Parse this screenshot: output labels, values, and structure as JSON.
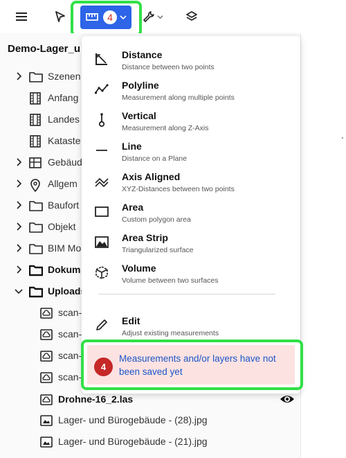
{
  "toolbar": {
    "menu_icon": "hamburger-icon",
    "select_icon": "cursor-arrow-icon",
    "measure_icon": "ruler-icon",
    "measure_badge": "4",
    "tools_icon": "wrench-icon",
    "layers_icon": "layers-icon",
    "accent_color": "#2d64e8"
  },
  "project": {
    "title": "Demo-Lager_u"
  },
  "tree": [
    {
      "label": "Szenen",
      "icon": "folder-icon",
      "bold": false,
      "chevron": "right"
    },
    {
      "label": "Anfang",
      "icon": "film-icon",
      "bold": false,
      "chevron": ""
    },
    {
      "label": "Landes",
      "icon": "film-icon",
      "bold": false,
      "chevron": ""
    },
    {
      "label": "Kataste",
      "icon": "film-icon",
      "bold": false,
      "chevron": ""
    },
    {
      "label": "Gebäud",
      "icon": "building-icon",
      "bold": false,
      "chevron": "right"
    },
    {
      "label": "Allgem",
      "icon": "location-pin-icon",
      "bold": false,
      "chevron": "right"
    },
    {
      "label": "Baufort",
      "icon": "folder-icon",
      "bold": false,
      "chevron": "right"
    },
    {
      "label": "Objekt",
      "icon": "folder-icon",
      "bold": false,
      "chevron": "right"
    },
    {
      "label": "BIM Mo",
      "icon": "folder-icon",
      "bold": false,
      "chevron": "right"
    },
    {
      "label": "Dokum",
      "icon": "folder-icon",
      "bold": true,
      "chevron": "right"
    },
    {
      "label": "Uploads",
      "icon": "folder-icon",
      "bold": true,
      "chevron": "down"
    },
    {
      "label": "scan-",
      "icon": "cloud-file-icon",
      "bold": false,
      "chevron": ""
    },
    {
      "label": "scan-",
      "icon": "cloud-file-icon",
      "bold": false,
      "chevron": ""
    },
    {
      "label": "scan-",
      "icon": "cloud-file-icon",
      "bold": false,
      "chevron": ""
    },
    {
      "label": "scan-",
      "icon": "cloud-file-icon",
      "bold": false,
      "chevron": ""
    },
    {
      "label": "Drohne-16_2.las",
      "icon": "cloud-file-icon",
      "bold": true,
      "chevron": "",
      "visible_eye": true
    },
    {
      "label": "Lager- und Bürogebäude -  (28).jpg",
      "icon": "image-file-icon",
      "bold": false,
      "chevron": ""
    },
    {
      "label": "Lager- und Bürogebäude -  (21).jpg",
      "icon": "image-file-icon",
      "bold": false,
      "chevron": ""
    }
  ],
  "measure_menu": {
    "items": [
      {
        "title": "Distance",
        "desc": "Distance between two points",
        "icon": "distance-icon"
      },
      {
        "title": "Polyline",
        "desc": "Measurement along multiple points",
        "icon": "polyline-icon"
      },
      {
        "title": "Vertical",
        "desc": "Measurement along Z-Axis",
        "icon": "vertical-icon"
      },
      {
        "title": "Line",
        "desc": "Distance on a Plane",
        "icon": "line-icon"
      },
      {
        "title": "Axis Aligned",
        "desc": "XYZ-Distances between two points",
        "icon": "axis-aligned-icon"
      },
      {
        "title": "Area",
        "desc": "Custom polygon area",
        "icon": "area-icon"
      },
      {
        "title": "Area Strip",
        "desc": "Triangularized surface",
        "icon": "area-strip-icon"
      },
      {
        "title": "Volume",
        "desc": "Volume between two surfaces",
        "icon": "volume-icon"
      }
    ],
    "edit": {
      "title": "Edit",
      "desc": "Adjust existing measurements",
      "icon": "pencil-icon"
    }
  },
  "warning": {
    "badge": "4",
    "text": "Measurements and/or layers have not been saved yet",
    "bg_color": "#fde2e2",
    "text_color": "#1a56c8"
  },
  "highlight_color": "#31e047"
}
